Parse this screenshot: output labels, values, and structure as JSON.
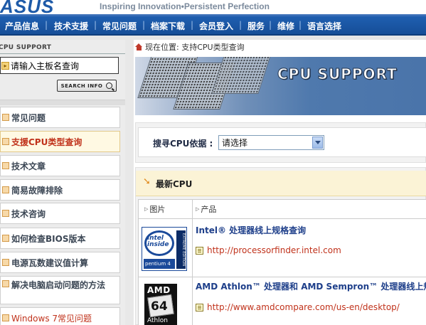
{
  "header": {
    "logo": "ASUS",
    "tagline": "Inspiring Innovation•Persistent Perfection"
  },
  "nav": {
    "items": [
      "产品信息",
      "技术支援",
      "常见问题",
      "档案下载",
      "会员登入",
      "服务",
      "维修",
      "语言选择"
    ]
  },
  "sidebar": {
    "title": "CPU SUPPORT",
    "search_placeholder": "请输入主板名查询",
    "search_value": "请输入主板名查询",
    "search_button": "SEARCH INFO",
    "items": [
      {
        "label": "常见问题"
      },
      {
        "label": "支援CPU类型查询"
      },
      {
        "label": "技术文章"
      },
      {
        "label": "简易故障排除"
      },
      {
        "label": "技术咨询"
      },
      {
        "label": "如何检查BIOS版本"
      },
      {
        "label": "电源瓦数建议值计算"
      },
      {
        "label": "解决电脑启动问题的方法"
      },
      {
        "label": "Windows 7常见问题"
      }
    ]
  },
  "main": {
    "breadcrumb": "现在位置: 支持CPU类型查询",
    "banner_title": "CPU SUPPORT",
    "cpu_basis_label": "搜寻CPU依据 :",
    "cpu_select_value": "请选择",
    "latest_title": "最新CPU",
    "table": {
      "headers": [
        "图片",
        "产品"
      ],
      "rows": [
        {
          "name": "Intel® 处理器线上规格查询",
          "link": "http://processorfinder.intel.com",
          "logo_lines": [
            "intel",
            "inside",
            "pentium 4",
            "EXTREME EDITION"
          ]
        },
        {
          "name": "AMD Athlon™ 处理器和  AMD Sempron™ 处理器线上规格",
          "link": "http://www.amdcompare.com/us-en/desktop/",
          "logo_lines": [
            "AMD",
            "64",
            "Athlon"
          ]
        }
      ]
    }
  },
  "colors": {
    "nav_blue": "#1f5fb0",
    "accent_red": "#c0321b",
    "link_blue": "#1e3f8a",
    "highlight_yellow": "#fbf3d6"
  }
}
